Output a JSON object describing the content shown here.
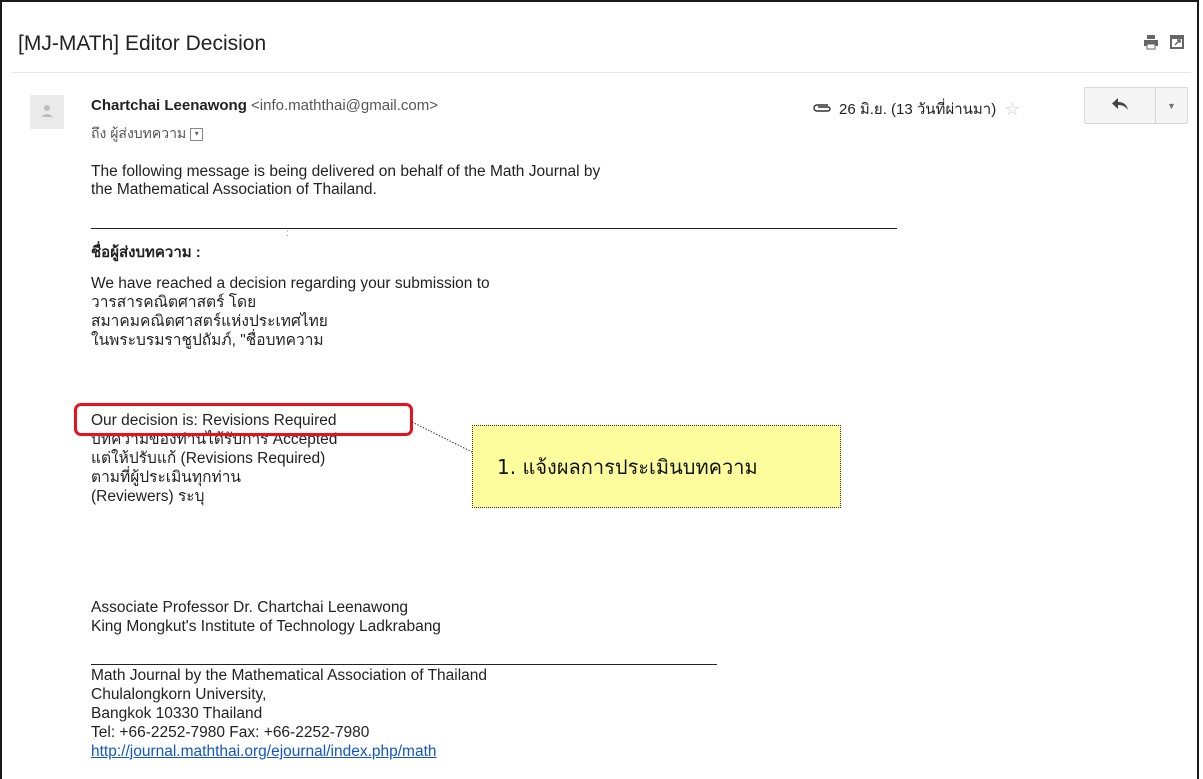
{
  "email": {
    "subject": "[MJ-MATh] Editor Decision",
    "sender_name": "Chartchai Leenawong",
    "sender_email": "<info.maththai@gmail.com>",
    "to": "ถึง ผู้ส่งบทความ",
    "date": "26 มิ.ย. (13 วันที่ผ่านมา)"
  },
  "icons": [
    "print-icon",
    "new-window-icon",
    "default-avatar-icon",
    "attachment-icon",
    "star-icon",
    "reply-icon",
    "more-options-icon",
    "to-details-dropdown-icon"
  ],
  "body": {
    "intro_1": "The following message is being delivered on behalf of the Math Journal by",
    "intro_2": "the Mathematical Association of Thailand.",
    "colon_mark": ":",
    "salutation": "ชื่อผู้ส่งบทความ :",
    "para_1": "We have reached a decision regarding your submission to",
    "para_2": "วารสารคณิตศาสตร์ โดย",
    "para_3": "สมาคมคณิตศาสตร์แห่งประเทศไทย",
    "para_4": "ในพระบรมราชูปถัมภ์, \"ชื่อบทความ",
    "decision": "Our decision is: Revisions Required",
    "decision_detail_1": "บทความของท่านได้รับการ Accepted",
    "decision_detail_2": "แต่ให้ปรับแก้ (Revisions Required)",
    "decision_detail_3": "ตามที่ผู้ประเมินทุกท่าน",
    "decision_detail_4": "(Reviewers) ระบุ",
    "sig_name": "Associate Professor Dr. Chartchai Leenawong",
    "sig_affiliation": "King Mongkut's Institute of Technology Ladkrabang",
    "footer_1": "Math Journal by the Mathematical Association of Thailand",
    "footer_2": "Chulalongkorn University,",
    "footer_3": "Bangkok 10330 Thailand",
    "footer_4": "Tel: +66-2252-7980 Fax: +66-2252-7980",
    "footer_link": "http://journal.maththai.org/ejournal/index.php/math"
  },
  "annotation": {
    "callout_text": "1. แจ้งผลการประเมินบทความ",
    "highlight_color": "#e8131a",
    "callout_bg": "#fdfd9e"
  }
}
